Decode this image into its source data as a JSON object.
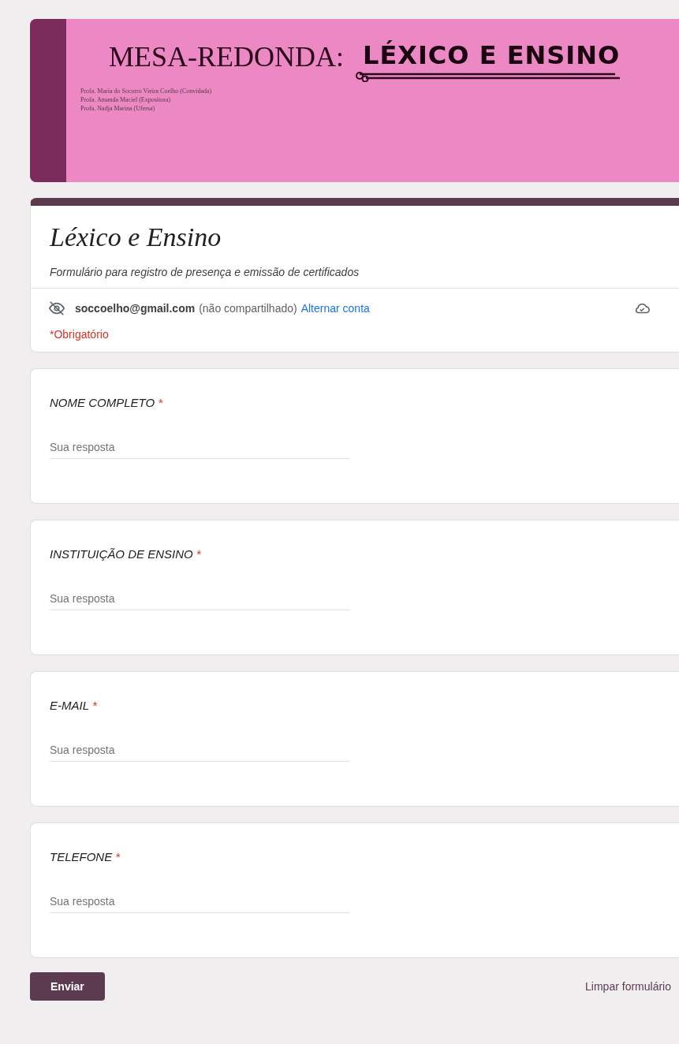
{
  "banner": {
    "title": "MESA-REDONDA:",
    "title_stylized": "LÉXICO E ENSINO",
    "credits": [
      "Profa. Maria do Socorro Vieira Coelho (Convidada)",
      "Profa. Amanda Maciel (Expositora)",
      "Profa. Nadja Marina (Ufersa)"
    ]
  },
  "form": {
    "title": "Léxico e Ensino",
    "description": "Formulário para registro de presença e emissão de certificados",
    "account": {
      "email": "soccoelho@gmail.com",
      "note": "(não compartilhado)",
      "switch_link": "Alternar conta"
    },
    "required_note": "*Obrigatório"
  },
  "questions": [
    {
      "label": "NOME COMPLETO",
      "required_mark": "*",
      "placeholder": "Sua resposta"
    },
    {
      "label": "INSTITUIÇÃO DE ENSINO",
      "required_mark": "*",
      "placeholder": "Sua resposta"
    },
    {
      "label": "E-MAIL",
      "required_mark": "*",
      "placeholder": "Sua resposta"
    },
    {
      "label": "TELEFONE",
      "required_mark": "*",
      "placeholder": "Sua resposta"
    }
  ],
  "actions": {
    "submit": "Enviar",
    "clear": "Limpar formulário"
  }
}
